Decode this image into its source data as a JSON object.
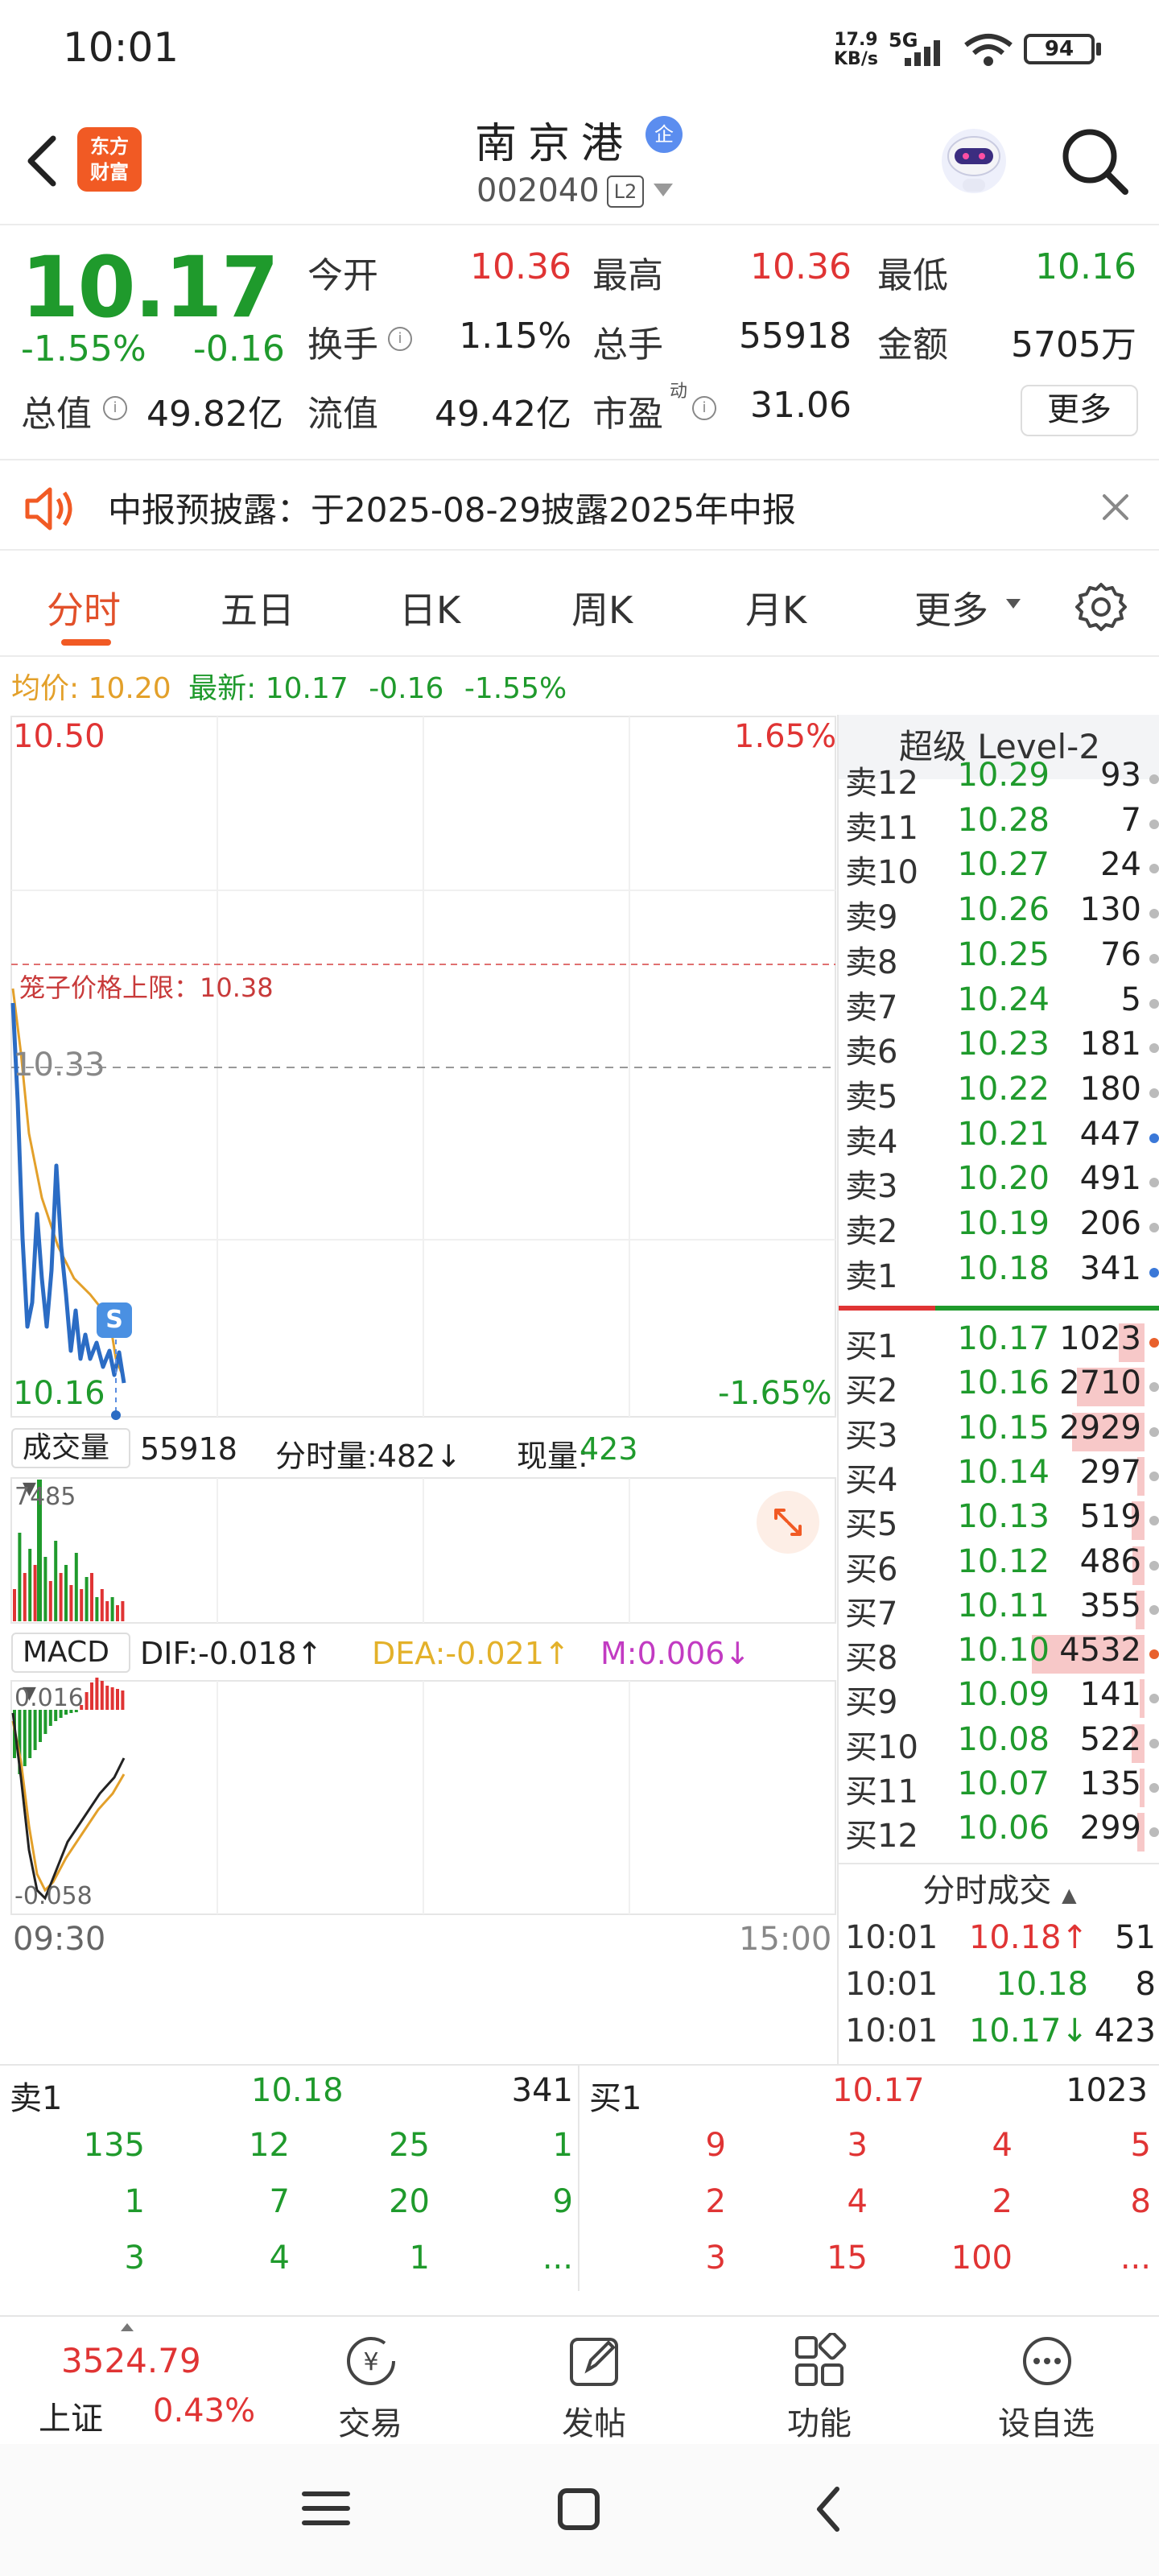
{
  "status_bar": {
    "time": "10:01",
    "speed_value": "17.9",
    "speed_unit": "KB/s",
    "network": "5G",
    "battery": "94"
  },
  "header": {
    "back": "back",
    "logo_line1": "东方",
    "logo_line2": "财富",
    "stock_name": "南京港",
    "badge": "企",
    "stock_code": "002040",
    "l2": "L2"
  },
  "quote": {
    "price": "10.17",
    "change_pct": "-1.55%",
    "change_amt": "-0.16",
    "open_label": "今开",
    "open": "10.36",
    "high_label": "最高",
    "high": "10.36",
    "low_label": "最低",
    "low": "10.16",
    "turnover_label": "换手",
    "turnover": "1.15%",
    "volume_label": "总手",
    "volume": "55918",
    "amount_label": "金额",
    "amount": "5705万",
    "mktcap_label": "总值",
    "mktcap": "49.82亿",
    "float_label": "流值",
    "float_cap": "49.42亿",
    "pe_label": "市盈",
    "pe_sup": "动",
    "pe": "31.06",
    "more": "更多"
  },
  "notice": {
    "text": "中报预披露：于2025-08-29披露2025年中报"
  },
  "tabs": [
    "分时",
    "五日",
    "日K",
    "周K",
    "月K",
    "更多"
  ],
  "avg_line": {
    "avg_label": "均价:",
    "avg": "10.20",
    "latest_label": "最新:",
    "latest": "10.17",
    "chg": "-0.16",
    "pct": "-1.55%"
  },
  "chart": {
    "top_price": "10.50",
    "top_pct": "1.65%",
    "bottom_price": "10.16",
    "bottom_pct": "-1.65%",
    "ref_price": "10.33",
    "cage_label": "笼子价格上限：10.38",
    "s_marker": "S",
    "vol_label": "成交量",
    "vol_total": "55918",
    "vol_min": "分时量:482↓",
    "vol_now_label": "现量:",
    "vol_now": "423",
    "vol_max": "7485",
    "macd_label": "MACD",
    "dif": "DIF:-0.018↑",
    "dea": "DEA:-0.021↑",
    "m": "M:0.006↓",
    "macd_top": "0.016",
    "macd_bottom": "-0.058",
    "time_start": "09:30",
    "time_end": "15:00"
  },
  "order_book": {
    "title": "超级 Level-2",
    "asks": [
      {
        "label": "卖12",
        "price": "10.29",
        "vol": "93"
      },
      {
        "label": "卖11",
        "price": "10.28",
        "vol": "7"
      },
      {
        "label": "卖10",
        "price": "10.27",
        "vol": "24"
      },
      {
        "label": "卖9",
        "price": "10.26",
        "vol": "130"
      },
      {
        "label": "卖8",
        "price": "10.25",
        "vol": "76"
      },
      {
        "label": "卖7",
        "price": "10.24",
        "vol": "5"
      },
      {
        "label": "卖6",
        "price": "10.23",
        "vol": "181"
      },
      {
        "label": "卖5",
        "price": "10.22",
        "vol": "180"
      },
      {
        "label": "卖4",
        "price": "10.21",
        "vol": "447"
      },
      {
        "label": "卖3",
        "price": "10.20",
        "vol": "491"
      },
      {
        "label": "卖2",
        "price": "10.19",
        "vol": "206"
      },
      {
        "label": "卖1",
        "price": "10.18",
        "vol": "341"
      }
    ],
    "bids": [
      {
        "label": "买1",
        "price": "10.17",
        "vol": "1023"
      },
      {
        "label": "买2",
        "price": "10.16",
        "vol": "2710"
      },
      {
        "label": "买3",
        "price": "10.15",
        "vol": "2929"
      },
      {
        "label": "买4",
        "price": "10.14",
        "vol": "297"
      },
      {
        "label": "买5",
        "price": "10.13",
        "vol": "519"
      },
      {
        "label": "买6",
        "price": "10.12",
        "vol": "486"
      },
      {
        "label": "买7",
        "price": "10.11",
        "vol": "355"
      },
      {
        "label": "买8",
        "price": "10.10",
        "vol": "4532"
      },
      {
        "label": "买9",
        "price": "10.09",
        "vol": "141"
      },
      {
        "label": "买10",
        "price": "10.08",
        "vol": "522"
      },
      {
        "label": "买11",
        "price": "10.07",
        "vol": "135"
      },
      {
        "label": "买12",
        "price": "10.06",
        "vol": "299"
      }
    ],
    "ticks_title": "分时成交",
    "ticks": [
      {
        "time": "10:01",
        "price": "10.18↑",
        "vol": "51"
      },
      {
        "time": "10:01",
        "price": "10.18",
        "vol": "8"
      },
      {
        "time": "10:01",
        "price": "10.17↓",
        "vol": "423"
      }
    ]
  },
  "queue": {
    "ask_label": "卖1",
    "ask_price": "10.18",
    "ask_vol": "341",
    "bid_label": "买1",
    "bid_price": "10.17",
    "bid_vol": "1023",
    "ask_rows": [
      [
        "135",
        "12",
        "25",
        "1"
      ],
      [
        "1",
        "7",
        "20",
        "9"
      ],
      [
        "3",
        "4",
        "1",
        "..."
      ]
    ],
    "bid_rows": [
      [
        "9",
        "3",
        "4",
        "5"
      ],
      [
        "2",
        "4",
        "2",
        "8"
      ],
      [
        "3",
        "15",
        "100",
        "..."
      ]
    ]
  },
  "bottom_nav": {
    "index_value": "3524.79",
    "index_name": "上证",
    "index_pct": "0.43%",
    "items": [
      "交易",
      "发帖",
      "功能",
      "设自选"
    ]
  },
  "colors": {
    "up": "#e03434",
    "down": "#1f9a2c",
    "accent": "#f15a24",
    "avg": "#e3a02a",
    "price_line": "#2b6cc4"
  }
}
